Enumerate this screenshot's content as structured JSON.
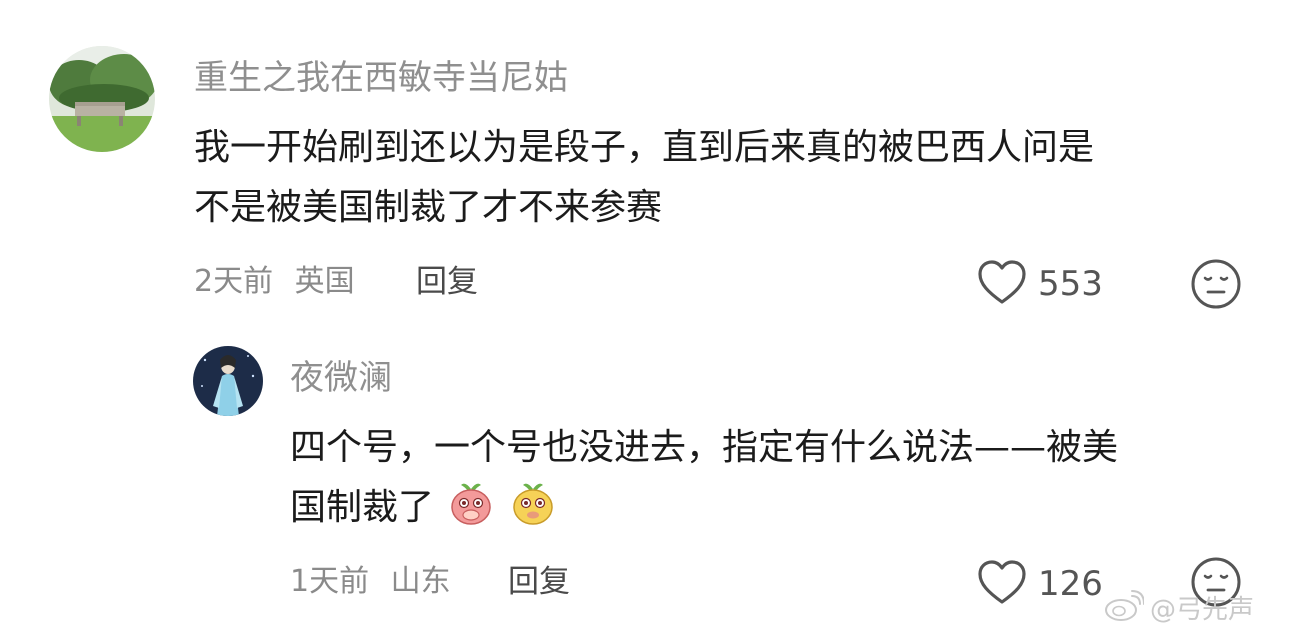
{
  "comment": {
    "username": "重生之我在西敏寺当尼姑",
    "lines": [
      "我一开始刷到还以为是段子，直到后来真的被巴西人问是",
      "不是被美国制裁了才不来参赛"
    ],
    "time": "2天前",
    "location": "英国",
    "reply_label": "回复",
    "likes": "553",
    "avatar_icon": "garden-bench-photo",
    "like_icon": "heart-outline-icon",
    "emoji_icon": "neutral-face-icon"
  },
  "reply": {
    "username": "夜微澜",
    "lines": [
      "四个号，一个号也没进去，指定有什么说法——被美",
      "国制裁了"
    ],
    "stickers": [
      "pink-peach-shy-sticker",
      "yellow-peach-shy-sticker"
    ],
    "time": "1天前",
    "location": "山东",
    "reply_label": "回复",
    "likes": "126",
    "avatar_icon": "ancient-costume-figure-avatar",
    "like_icon": "heart-outline-icon",
    "emoji_icon": "neutral-face-icon"
  },
  "watermark": {
    "text": "@弓先声",
    "icon": "weibo-logo-icon"
  }
}
